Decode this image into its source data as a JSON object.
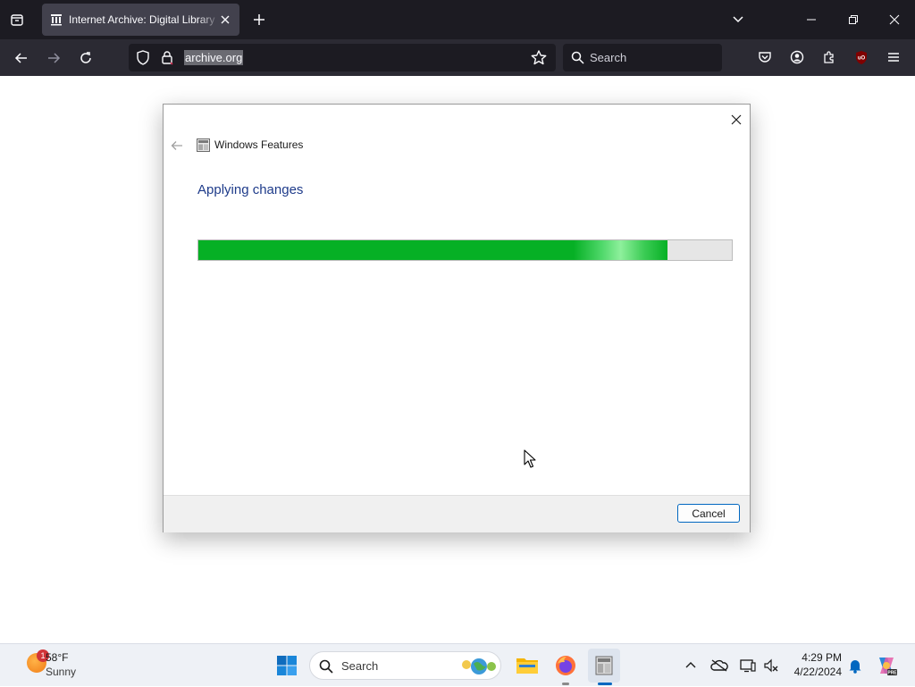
{
  "browser": {
    "tab_title": "Internet Archive: Digital Library",
    "url": "archive.org",
    "search_placeholder": "Search"
  },
  "dialog": {
    "window_title": "Windows Features",
    "heading": "Applying changes",
    "progress_fraction": 0.88,
    "cancel_label": "Cancel",
    "progress_color": "#06b025"
  },
  "taskbar": {
    "weather": {
      "temperature": "58°F",
      "condition": "Sunny",
      "badge": "1"
    },
    "search_label": "Search",
    "clock": {
      "time": "4:29 PM",
      "date": "4/22/2024"
    },
    "pinned": [
      "search-highlight-icon",
      "file-explorer-icon",
      "firefox-icon",
      "windows-features-icon"
    ],
    "tray": [
      "chevron-up-icon",
      "onedrive-icon",
      "display-icon",
      "network-icon",
      "notification-bell-icon",
      "copilot-icon"
    ]
  },
  "colors": {
    "accent": "#0067c0",
    "browser_bg": "#1c1b22"
  }
}
